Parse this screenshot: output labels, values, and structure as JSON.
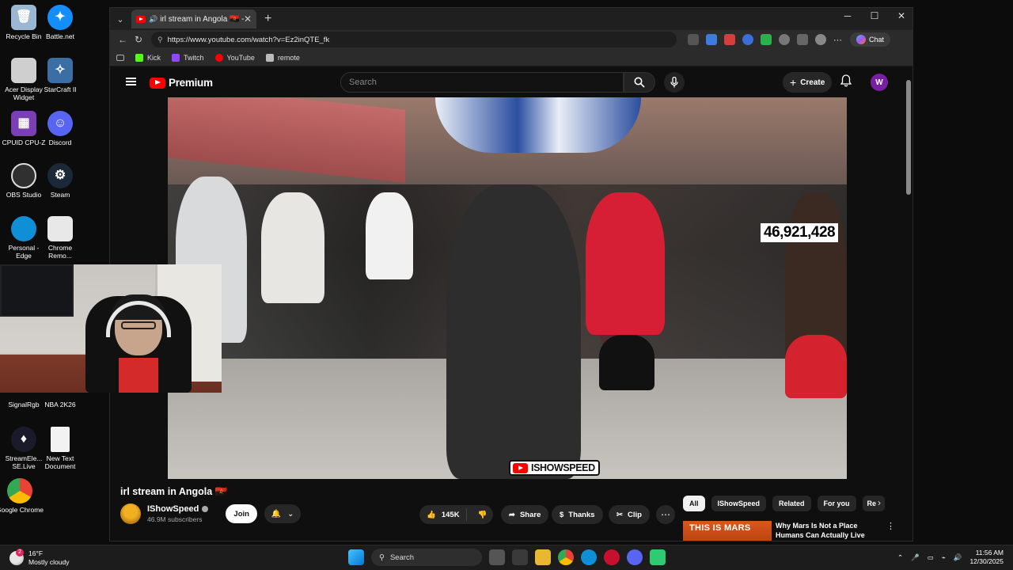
{
  "desktop": {
    "icons": [
      {
        "label": "Recycle Bin",
        "color": "#9bb7d4"
      },
      {
        "label": "Battle.net",
        "color": "#148eff"
      },
      {
        "label": "Acer Display Widget",
        "color": "#cfcfcf"
      },
      {
        "label": "StarCraft II",
        "color": "#3a6ea5"
      },
      {
        "label": "CPUID CPU-Z",
        "color": "#7b3fb5"
      },
      {
        "label": "Discord",
        "color": "#5865f2"
      },
      {
        "label": "OBS Studio",
        "color": "#303030"
      },
      {
        "label": "Steam",
        "color": "#1b2838"
      },
      {
        "label": "Personal - Edge",
        "color": "#0f8fd6"
      },
      {
        "label": "Chrome Remo...",
        "color": "#e8e8e8"
      },
      {
        "label": "SignalRgb",
        "color": "#6a3fb5"
      },
      {
        "label": "NBA 2K26",
        "color": "#c81e1e"
      },
      {
        "label": "StreamEle... SE.Live",
        "color": "#1a1a2a"
      },
      {
        "label": "New Text Document",
        "color": "#f2f2f2"
      },
      {
        "label": "Google Chrome",
        "color": "#ea4335"
      }
    ]
  },
  "browser": {
    "tab_title": "irl stream in Angola 🇦🇴 - YouT",
    "url": "https://www.youtube.com/watch?v=Ez2inQTE_fk",
    "chat_label": "Chat",
    "favorites": [
      {
        "label": "Kick",
        "color": "#53fc18"
      },
      {
        "label": "Twitch",
        "color": "#9146ff"
      },
      {
        "label": "YouTube",
        "color": "#ff0000"
      },
      {
        "label": "remote",
        "color": "#bbbbbb"
      }
    ]
  },
  "youtube": {
    "logo_text": "Premium",
    "search_placeholder": "Search",
    "create_label": "Create",
    "avatar_letter": "W",
    "video": {
      "counter": "46,921,428",
      "watermark": "ISHOWSPEED"
    },
    "title": "irl stream in Angola 🇦🇴",
    "channel": {
      "name": "IShowSpeed",
      "subscribers": "46.9M subscribers",
      "join_label": "Join"
    },
    "actions": {
      "likes": "145K",
      "share": "Share",
      "thanks": "Thanks",
      "clip": "Clip"
    },
    "chips": [
      "All",
      "IShowSpeed",
      "Related",
      "For you",
      "Re"
    ],
    "recommended": {
      "thumb_text": "THIS IS MARS",
      "title": "Why Mars Is Not a Place Humans Can Actually Live"
    }
  },
  "taskbar": {
    "weather_temp": "16°F",
    "weather_desc": "Mostly cloudy",
    "weather_badge": "2",
    "search_label": "Search",
    "time": "11:56 AM",
    "date": "12/30/2025"
  }
}
